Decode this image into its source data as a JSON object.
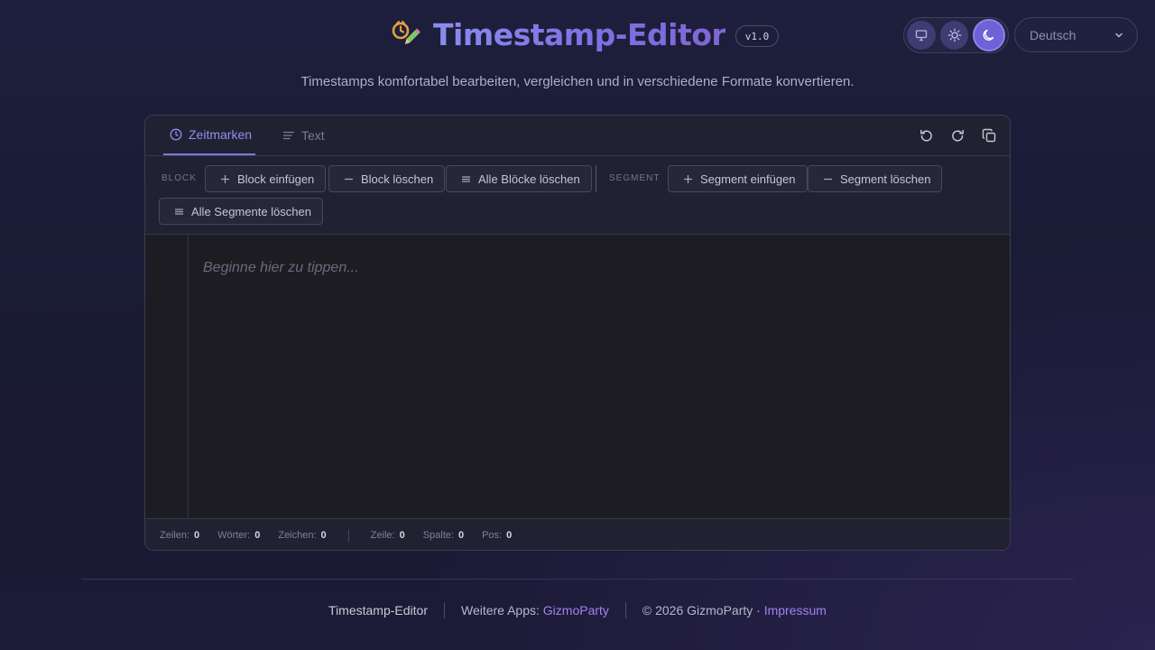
{
  "header": {
    "title": "Timestamp-Editor",
    "version": "v1.0",
    "subtitle": "Timestamps komfortabel bearbeiten, vergleichen und in verschiedene Formate konvertieren.",
    "theme_options": [
      "system-icon",
      "sun-icon",
      "moon-icon"
    ],
    "theme_active": "moon-icon",
    "language": "Deutsch"
  },
  "tabs": [
    {
      "label": "Zeitmarken",
      "icon": "clock-icon",
      "active": true
    },
    {
      "label": "Text",
      "icon": "text-lines-icon",
      "active": false
    }
  ],
  "toolbar": {
    "block_label": "BLOCK",
    "block_insert": "Block einfügen",
    "block_delete": "Block löschen",
    "block_delete_all": "Alle Blöcke löschen",
    "segment_label": "SEGMENT",
    "segment_insert": "Segment einfügen",
    "segment_delete": "Segment löschen",
    "segment_delete_all": "Alle Segmente löschen"
  },
  "editor": {
    "placeholder": "Beginne hier zu tippen..."
  },
  "status": {
    "lines_label": "Zeilen:",
    "lines": "0",
    "words_label": "Wörter:",
    "words": "0",
    "chars_label": "Zeichen:",
    "chars": "0",
    "row_label": "Zeile:",
    "row": "0",
    "col_label": "Spalte:",
    "col": "0",
    "pos_label": "Pos:",
    "pos": "0"
  },
  "footer": {
    "app_name": "Timestamp-Editor",
    "more_apps_label": "Weitere Apps:",
    "more_apps_link": "GizmoParty",
    "copyright": "© 2026 GizmoParty ·",
    "imprint": "Impressum"
  },
  "colors": {
    "accent": "#7b78e6",
    "link": "#a183ee",
    "background": "#1d1f3c"
  }
}
